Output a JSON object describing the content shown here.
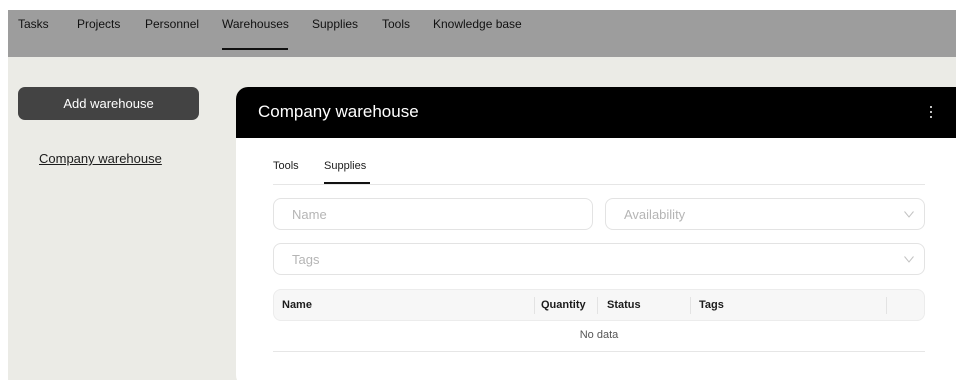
{
  "topnav": {
    "items": [
      "Tasks",
      "Projects",
      "Personnel",
      "Warehouses",
      "Supplies",
      "Tools",
      "Knowledge base"
    ],
    "active": "Warehouses"
  },
  "sidebar": {
    "add_button": "Add warehouse",
    "warehouses": [
      "Company warehouse"
    ]
  },
  "panel": {
    "title": "Company warehouse",
    "tabs": [
      "Tools",
      "Supplies"
    ],
    "active_tab": "Supplies",
    "filters": {
      "name_placeholder": "Name",
      "availability_placeholder": "Availability",
      "tags_placeholder": "Tags"
    },
    "table": {
      "columns": [
        "Name",
        "Quantity",
        "Status",
        "Tags"
      ],
      "empty_text": "No data"
    }
  },
  "colors": {
    "nav_bg": "#9d9d9d",
    "page_bg": "#ebebe6",
    "button_bg": "#434343",
    "panel_header_bg": "#000000"
  }
}
